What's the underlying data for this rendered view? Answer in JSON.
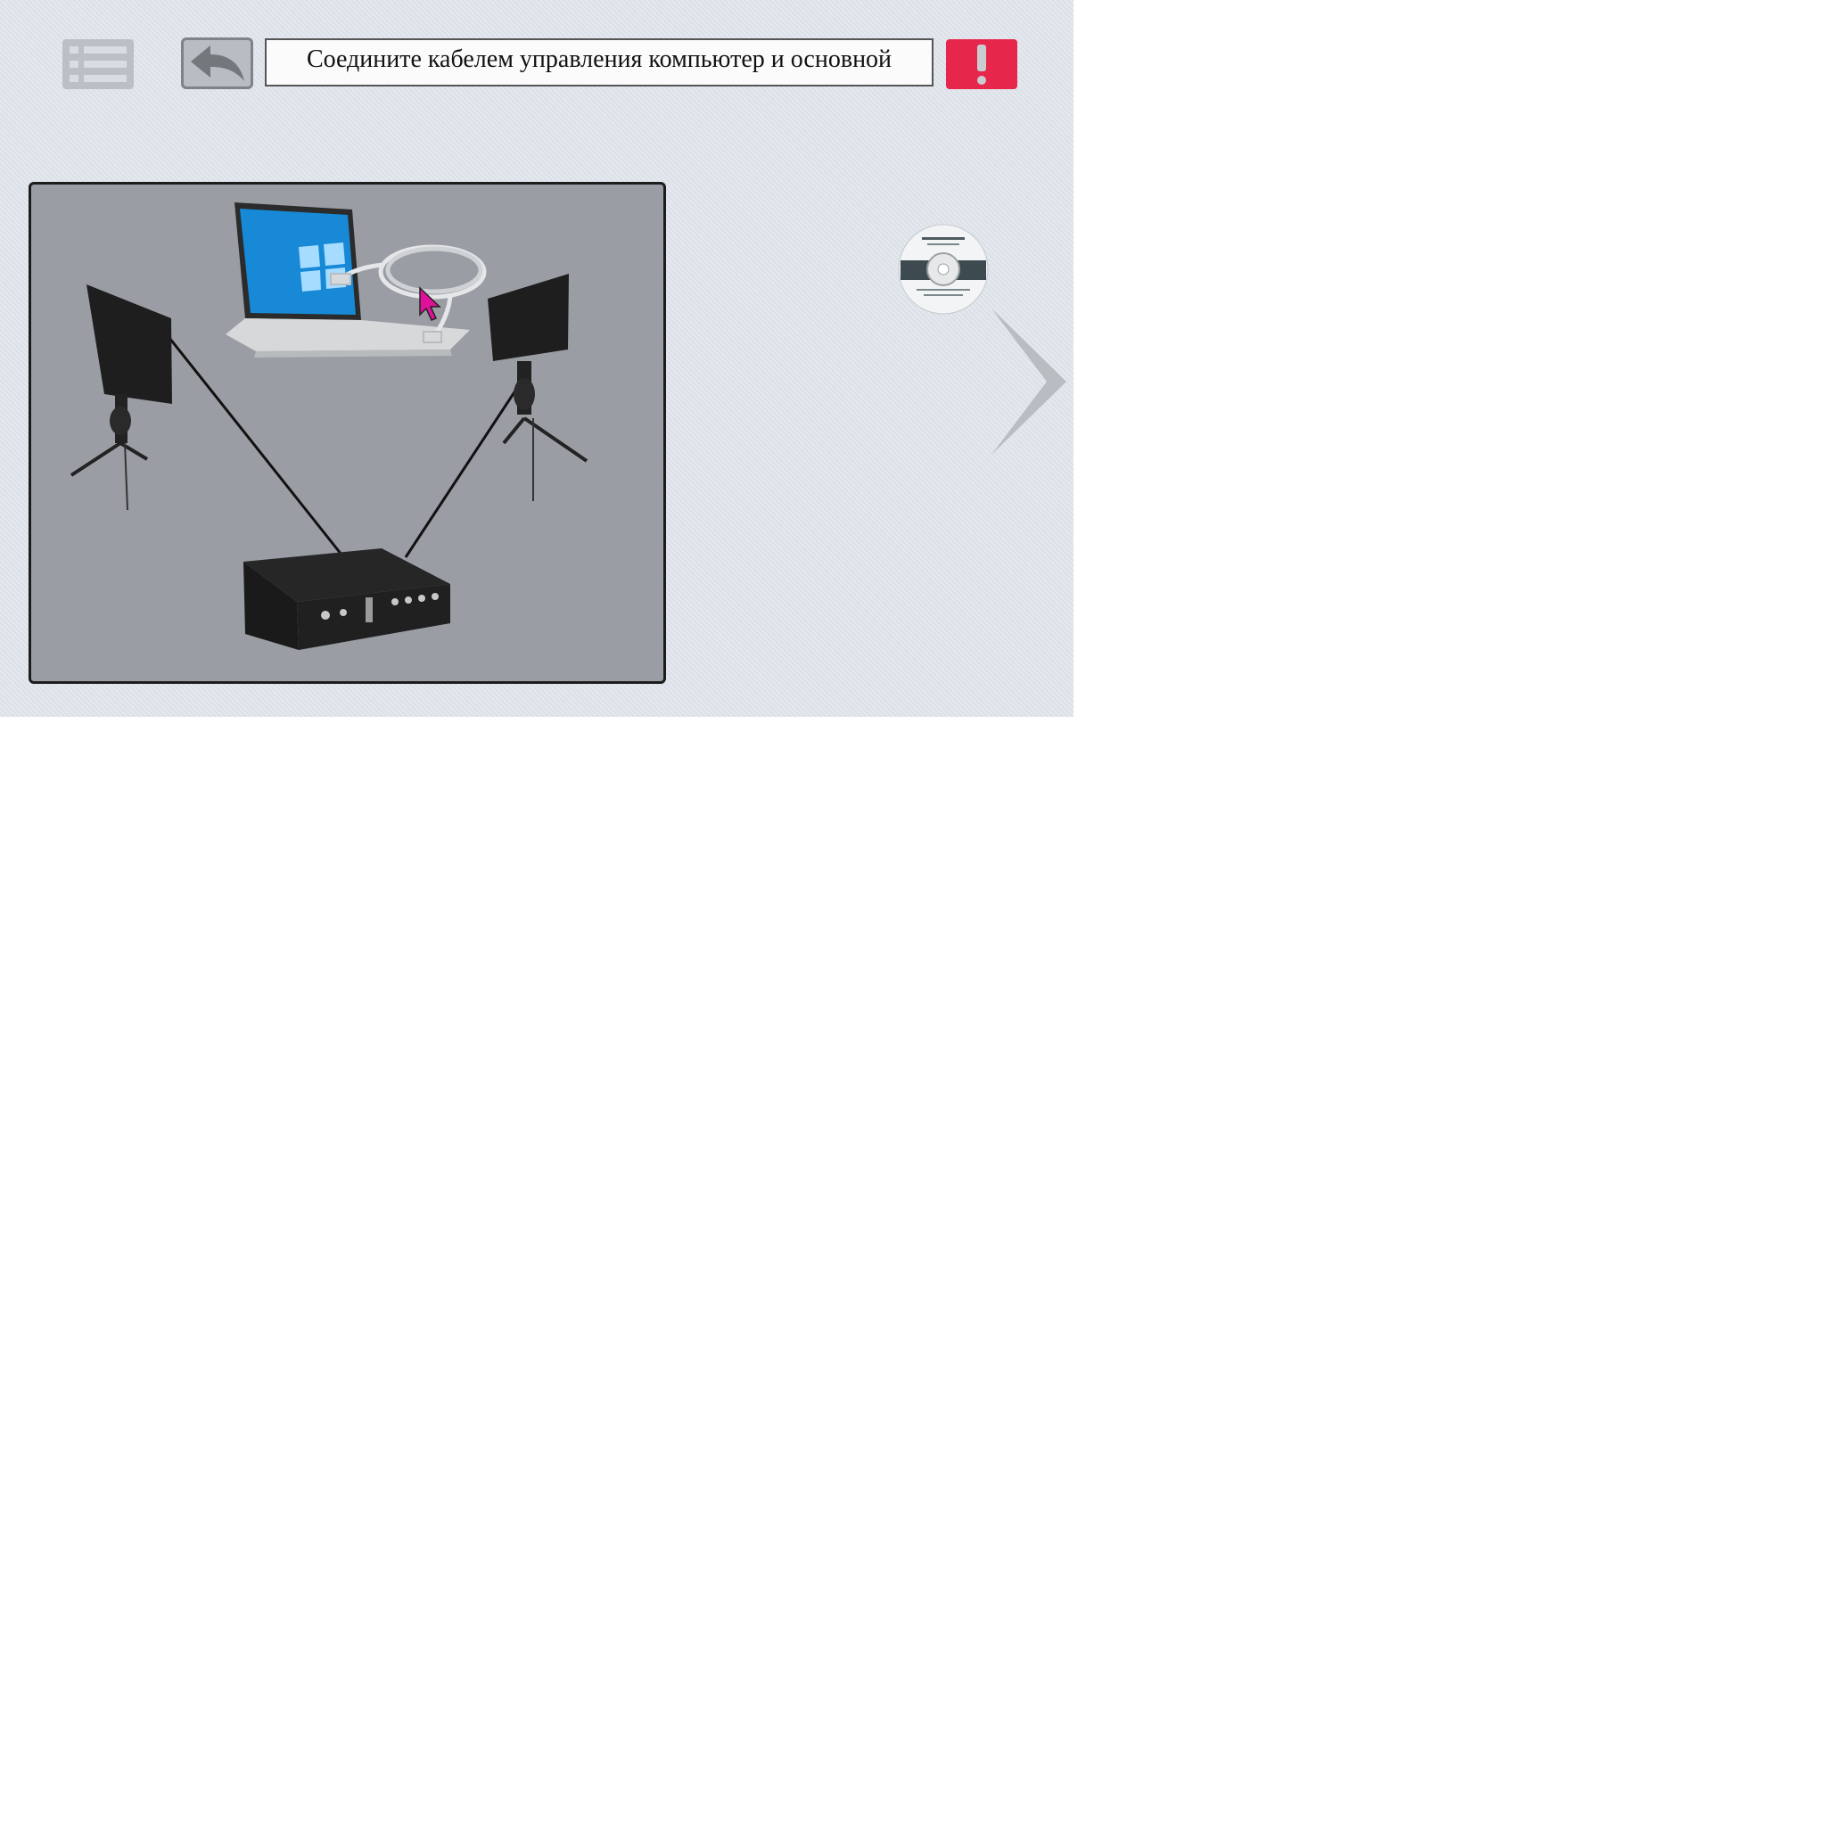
{
  "toolbar": {
    "menu_icon": "list-icon",
    "back_icon": "undo-arrow-icon",
    "alert_icon": "exclamation-icon",
    "instruction": "Соедините кабелем управления компьютер и основной",
    "colors": {
      "alert": "#e7264b",
      "button": "#bcc0c6",
      "background": "#dfe4ec"
    }
  },
  "scene": {
    "items": [
      "laptop",
      "ethernet-cable",
      "antenna-left",
      "antenna-right",
      "base-unit"
    ]
  },
  "disc": {
    "icon": "software-disc-icon"
  },
  "navigation": {
    "next_icon": "chevron-right-icon"
  },
  "cursor": {
    "icon": "mouse-pointer-icon",
    "color": "#e0109b"
  }
}
